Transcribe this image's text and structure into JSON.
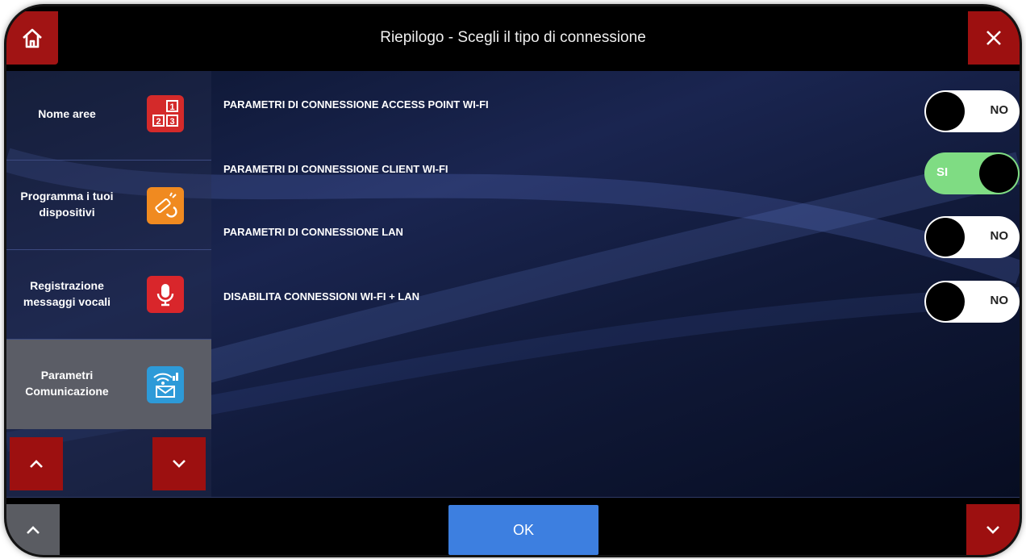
{
  "header": {
    "title": "Riepilogo - Scegli il tipo di connessione",
    "home_icon": "home-icon",
    "close_icon": "close-icon"
  },
  "sidebar": {
    "items": [
      {
        "label": "Nome aree",
        "icon": "area-grid-icon",
        "active": false
      },
      {
        "label": "Programma i tuoi dispositivi",
        "icon": "device-program-icon",
        "active": false
      },
      {
        "label": "Registrazione messaggi vocali",
        "icon": "microphone-icon",
        "active": false
      },
      {
        "label": "Parametri Comunicazione",
        "icon": "wifi-message-icon",
        "active": true
      }
    ],
    "area_icon_numbers": [
      "1",
      "2",
      "3"
    ]
  },
  "settings": [
    {
      "label": "PARAMETRI DI CONNESSIONE ACCESS POINT WI-FI",
      "state": "NO",
      "on": false
    },
    {
      "label": "PARAMETRI DI CONNESSIONE CLIENT WI-FI",
      "state": "SI",
      "on": true
    },
    {
      "label": "PARAMETRI DI CONNESSIONE LAN",
      "state": "NO",
      "on": false
    },
    {
      "label": "DISABILITA CONNESSIONI WI-FI + LAN",
      "state": "NO",
      "on": false
    }
  ],
  "footer": {
    "ok_label": "OK"
  },
  "colors": {
    "accent_red": "#9d1010",
    "ok_blue": "#3d7fe0",
    "toggle_on_green": "#7fdc83"
  }
}
